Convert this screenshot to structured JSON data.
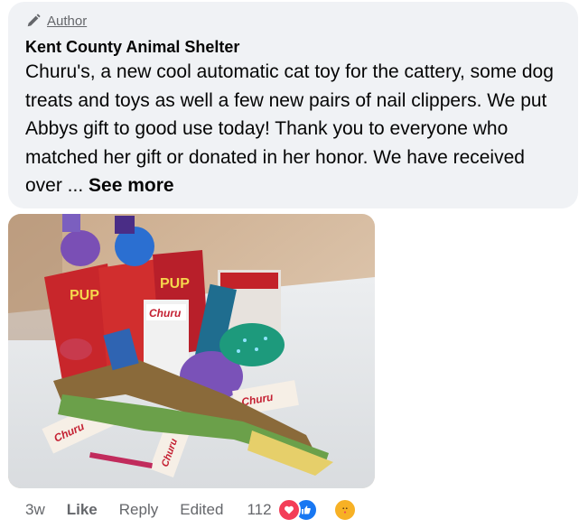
{
  "comment": {
    "author_badge": "Author",
    "author_name": "Kent County Animal Shelter",
    "text": "Churu's, a new cool automatic cat toy for the cattery, some dog treats and toys as well a few new pairs of nail clippers. We put Abbys gift to good use today! Thank you to everyone who matched her gift or donated in her honor. We have received over ...",
    "see_more": "See more"
  },
  "photo": {
    "labels": [
      "PUP",
      "PUP",
      "Churu",
      "Churu",
      "Churu",
      "Churu"
    ]
  },
  "actions": {
    "time": "3w",
    "like": "Like",
    "reply": "Reply",
    "edited": "Edited",
    "reaction_count": "112"
  },
  "reaction_icons": [
    "love-icon",
    "like-icon",
    "care-icon"
  ]
}
